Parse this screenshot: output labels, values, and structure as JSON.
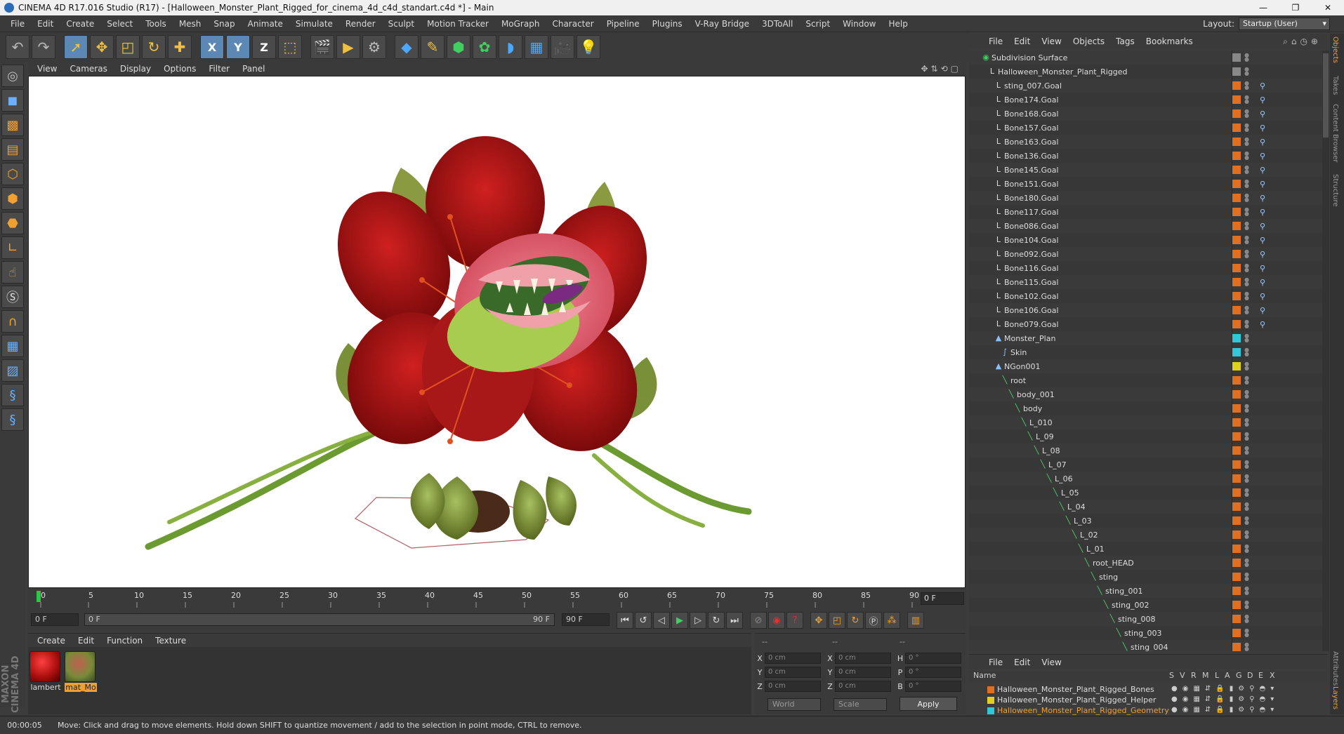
{
  "window": {
    "title": "CINEMA 4D R17.016 Studio (R17) - [Halloween_Monster_Plant_Rigged_for_cinema_4d_c4d_standart.c4d *] - Main",
    "controls": [
      "—",
      "❐",
      "✕"
    ]
  },
  "menubar": {
    "items": [
      "File",
      "Edit",
      "Create",
      "Select",
      "Tools",
      "Mesh",
      "Snap",
      "Animate",
      "Simulate",
      "Render",
      "Sculpt",
      "Motion Tracker",
      "MoGraph",
      "Character",
      "Pipeline",
      "Plugins",
      "V-Ray Bridge",
      "3DToAll",
      "Script",
      "Window",
      "Help"
    ],
    "layout_label": "Layout:",
    "layout_value": "Startup (User)"
  },
  "toolbar": {
    "icons": [
      "undo-icon",
      "redo-icon",
      "live-select-icon",
      "move-icon",
      "scale-icon",
      "rotate-icon",
      "transform-icon",
      "x-axis-icon",
      "y-axis-icon",
      "z-axis-icon",
      "coord-system-icon",
      "render-view-icon",
      "render-picture-viewer-icon",
      "render-settings-icon",
      "cube-icon",
      "pen-icon",
      "subdivision-icon",
      "mograph-cloner-icon",
      "deformer-icon",
      "floor-icon",
      "camera-icon",
      "light-icon"
    ],
    "axis_x": "X",
    "axis_y": "Y",
    "axis_z": "Z"
  },
  "viewport": {
    "menu": [
      "View",
      "Cameras",
      "Display",
      "Options",
      "Filter",
      "Panel"
    ]
  },
  "timeline": {
    "ticks": [
      "0",
      "5",
      "10",
      "15",
      "20",
      "25",
      "30",
      "35",
      "40",
      "45",
      "50",
      "55",
      "60",
      "65",
      "70",
      "75",
      "80",
      "85",
      "90"
    ],
    "current_frame": "0 F",
    "start_field": "0 F",
    "range_start": "0 F",
    "range_end": "90 F",
    "end_field": "90 F"
  },
  "materials": {
    "menu": [
      "Create",
      "Edit",
      "Function",
      "Texture"
    ],
    "items": [
      {
        "name": "lambert",
        "color": "#b01010"
      },
      {
        "name": "mat_Mo",
        "color": "#7a8a3a"
      }
    ]
  },
  "coordinates": {
    "headers": [
      "--",
      "--",
      "--"
    ],
    "rows": [
      {
        "l1": "X",
        "v1": "0 cm",
        "l2": "X",
        "v2": "0 cm",
        "l3": "H",
        "v3": "0 °"
      },
      {
        "l1": "Y",
        "v1": "0 cm",
        "l2": "Y",
        "v2": "0 cm",
        "l3": "P",
        "v3": "0 °"
      },
      {
        "l1": "Z",
        "v1": "0 cm",
        "l2": "Z",
        "v2": "0 cm",
        "l3": "B",
        "v3": "0 °"
      }
    ],
    "space": "World",
    "mode": "Scale",
    "apply": "Apply"
  },
  "status": {
    "time": "00:00:05",
    "message": "Move: Click and drag to move elements. Hold down SHIFT to quantize movement / add to the selection in point mode, CTRL to remove."
  },
  "object_manager": {
    "menu": [
      "File",
      "Edit",
      "View",
      "Objects",
      "Tags",
      "Bookmarks"
    ],
    "objects": [
      {
        "name": "Subdivision Surface",
        "depth": 0,
        "icon": "subdivision",
        "layer": "#888888"
      },
      {
        "name": "Halloween_Monster_Plant_Rigged",
        "depth": 1,
        "icon": "null",
        "layer": "#888888"
      },
      {
        "name": "sting_007.Goal",
        "depth": 2,
        "icon": "null",
        "layer": "#e07020"
      },
      {
        "name": "Bone174.Goal",
        "depth": 2,
        "icon": "null",
        "layer": "#e07020"
      },
      {
        "name": "Bone168.Goal",
        "depth": 2,
        "icon": "null",
        "layer": "#e07020"
      },
      {
        "name": "Bone157.Goal",
        "depth": 2,
        "icon": "null",
        "layer": "#e07020"
      },
      {
        "name": "Bone163.Goal",
        "depth": 2,
        "icon": "null",
        "layer": "#e07020"
      },
      {
        "name": "Bone136.Goal",
        "depth": 2,
        "icon": "null",
        "layer": "#e07020"
      },
      {
        "name": "Bone145.Goal",
        "depth": 2,
        "icon": "null",
        "layer": "#e07020"
      },
      {
        "name": "Bone151.Goal",
        "depth": 2,
        "icon": "null",
        "layer": "#e07020"
      },
      {
        "name": "Bone180.Goal",
        "depth": 2,
        "icon": "null",
        "layer": "#e07020"
      },
      {
        "name": "Bone117.Goal",
        "depth": 2,
        "icon": "null",
        "layer": "#e07020"
      },
      {
        "name": "Bone086.Goal",
        "depth": 2,
        "icon": "null",
        "layer": "#e07020"
      },
      {
        "name": "Bone104.Goal",
        "depth": 2,
        "icon": "null",
        "layer": "#e07020"
      },
      {
        "name": "Bone092.Goal",
        "depth": 2,
        "icon": "null",
        "layer": "#e07020"
      },
      {
        "name": "Bone116.Goal",
        "depth": 2,
        "icon": "null",
        "layer": "#e07020"
      },
      {
        "name": "Bone115.Goal",
        "depth": 2,
        "icon": "null",
        "layer": "#e07020"
      },
      {
        "name": "Bone102.Goal",
        "depth": 2,
        "icon": "null",
        "layer": "#e07020"
      },
      {
        "name": "Bone106.Goal",
        "depth": 2,
        "icon": "null",
        "layer": "#e07020"
      },
      {
        "name": "Bone079.Goal",
        "depth": 2,
        "icon": "null",
        "layer": "#e07020"
      },
      {
        "name": "Monster_Plan",
        "depth": 2,
        "icon": "poly",
        "layer": "#30c8d8"
      },
      {
        "name": "Skin",
        "depth": 3,
        "icon": "skin",
        "layer": "#30c8d8"
      },
      {
        "name": "NGon001",
        "depth": 2,
        "icon": "poly",
        "layer": "#e0d020"
      },
      {
        "name": "root",
        "depth": 3,
        "icon": "joint",
        "layer": "#e07020"
      },
      {
        "name": "body_001",
        "depth": 4,
        "icon": "joint",
        "layer": "#e07020"
      },
      {
        "name": "body",
        "depth": 5,
        "icon": "joint",
        "layer": "#e07020"
      },
      {
        "name": "L_010",
        "depth": 6,
        "icon": "joint",
        "layer": "#e07020"
      },
      {
        "name": "L_09",
        "depth": 7,
        "icon": "joint",
        "layer": "#e07020"
      },
      {
        "name": "L_08",
        "depth": 8,
        "icon": "joint",
        "layer": "#e07020"
      },
      {
        "name": "L_07",
        "depth": 9,
        "icon": "joint",
        "layer": "#e07020"
      },
      {
        "name": "L_06",
        "depth": 10,
        "icon": "joint",
        "layer": "#e07020"
      },
      {
        "name": "L_05",
        "depth": 11,
        "icon": "joint",
        "layer": "#e07020"
      },
      {
        "name": "L_04",
        "depth": 12,
        "icon": "joint",
        "layer": "#e07020"
      },
      {
        "name": "L_03",
        "depth": 13,
        "icon": "joint",
        "layer": "#e07020"
      },
      {
        "name": "L_02",
        "depth": 14,
        "icon": "joint",
        "layer": "#e07020"
      },
      {
        "name": "L_01",
        "depth": 15,
        "icon": "joint",
        "layer": "#e07020"
      },
      {
        "name": "root_HEAD",
        "depth": 16,
        "icon": "joint",
        "layer": "#e07020"
      },
      {
        "name": "sting",
        "depth": 17,
        "icon": "joint",
        "layer": "#e07020"
      },
      {
        "name": "sting_001",
        "depth": 18,
        "icon": "joint",
        "layer": "#e07020"
      },
      {
        "name": "sting_002",
        "depth": 19,
        "icon": "joint",
        "layer": "#e07020"
      },
      {
        "name": "sting_008",
        "depth": 20,
        "icon": "joint",
        "layer": "#e07020"
      },
      {
        "name": "sting_003",
        "depth": 21,
        "icon": "joint",
        "layer": "#e07020"
      },
      {
        "name": "sting_004",
        "depth": 22,
        "icon": "joint",
        "layer": "#e07020"
      }
    ],
    "side_tabs": [
      "Objects",
      "Takes",
      "Content Browser",
      "Structure"
    ]
  },
  "layer_manager": {
    "menu": [
      "File",
      "Edit",
      "View"
    ],
    "headers": [
      "Name",
      "S",
      "V",
      "R",
      "M",
      "L",
      "A",
      "G",
      "D",
      "E",
      "X"
    ],
    "layers": [
      {
        "name": "Halloween_Monster_Plant_Rigged_Bones",
        "color": "#e07020",
        "active": false
      },
      {
        "name": "Halloween_Monster_Plant_Rigged_Helper",
        "color": "#e0d020",
        "active": false
      },
      {
        "name": "Halloween_Monster_Plant_Rigged_Geometry",
        "color": "#30c8d8",
        "active": true
      }
    ],
    "side_tabs": [
      "Attributes",
      "Layers"
    ]
  },
  "logo": {
    "text": "MAXON CINEMA 4D"
  }
}
